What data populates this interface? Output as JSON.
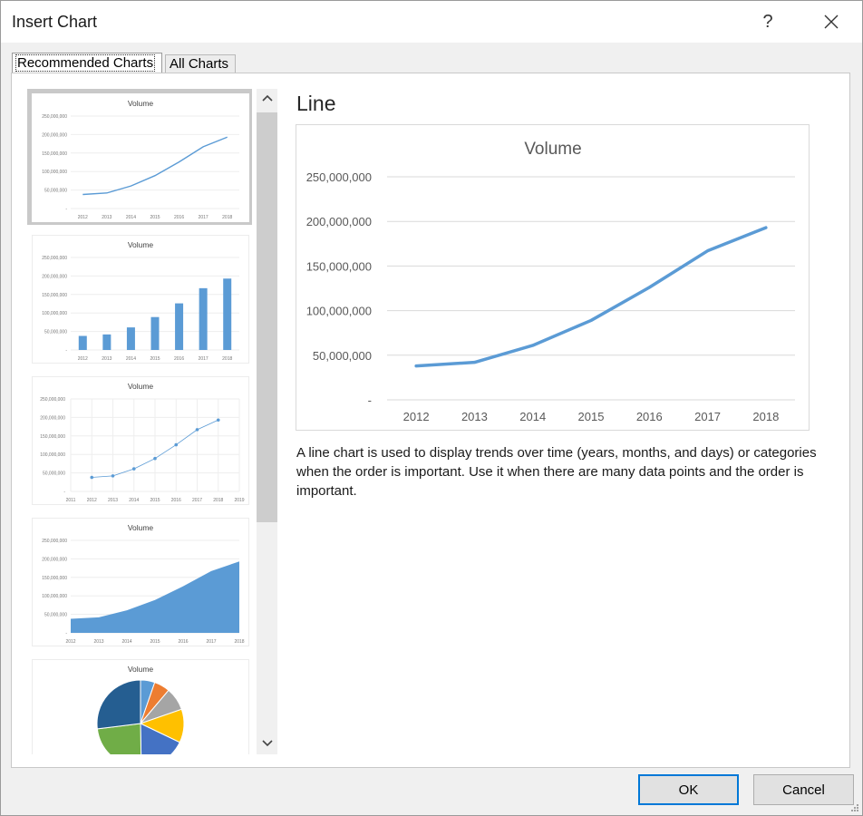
{
  "window": {
    "title": "Insert Chart",
    "help_label": "?",
    "close_label": "✕"
  },
  "tabs": [
    {
      "label": "Recommended Charts",
      "active": true
    },
    {
      "label": "All Charts",
      "active": false
    }
  ],
  "preview": {
    "title": "Line",
    "description": "A line chart is used to display trends over time (years, months, and days) or categories when the order is important. Use it when there are many data points and the order is important."
  },
  "buttons": {
    "ok": "OK",
    "cancel": "Cancel"
  },
  "colors": {
    "accent": "#5b9bd5",
    "selection": "#0078d7"
  },
  "icons": {
    "scroll_up": "chevron-up-icon",
    "scroll_down": "chevron-down-icon"
  },
  "chart_data": {
    "type": "line",
    "title": "Volume",
    "categories": [
      "2012",
      "2013",
      "2014",
      "2015",
      "2016",
      "2017",
      "2018"
    ],
    "values": [
      38000000,
      42000000,
      61000000,
      89000000,
      126000000,
      167000000,
      193000000
    ],
    "y_ticks": [
      "250,000,000",
      "200,000,000",
      "150,000,000",
      "100,000,000",
      "50,000,000",
      "-"
    ],
    "ylim": [
      0,
      250000000
    ],
    "grid": true,
    "legend": "none",
    "scatter_x_categories": [
      "2011",
      "2012",
      "2013",
      "2014",
      "2015",
      "2016",
      "2017",
      "2018",
      "2019"
    ],
    "pie_colors": [
      "#5b9bd5",
      "#ed7d31",
      "#a5a5a5",
      "#ffc000",
      "#4472c4",
      "#70ad47",
      "#255e91"
    ]
  },
  "gallery": [
    {
      "kind": "line",
      "title": "Volume"
    },
    {
      "kind": "column",
      "title": "Volume"
    },
    {
      "kind": "scatter",
      "title": "Volume"
    },
    {
      "kind": "area",
      "title": "Volume"
    },
    {
      "kind": "pie",
      "title": "Volume"
    }
  ]
}
